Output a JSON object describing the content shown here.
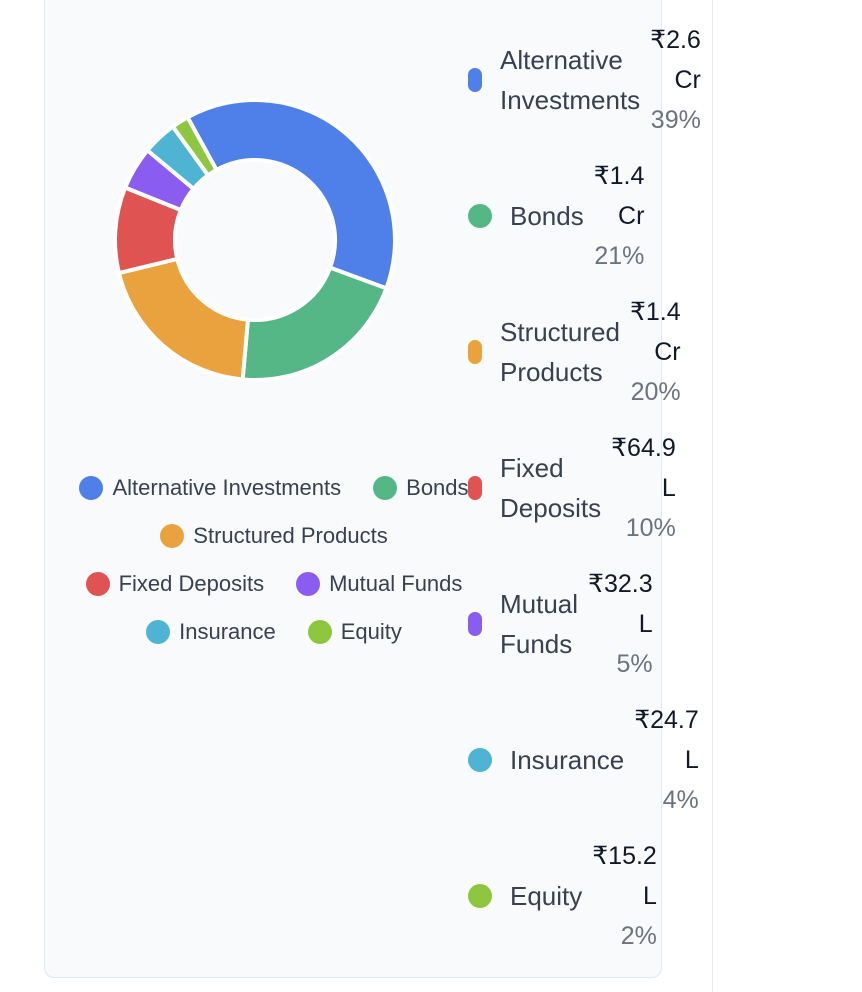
{
  "chart_data": {
    "type": "pie",
    "donut": true,
    "categories": [
      "Alternative Investments",
      "Bonds",
      "Structured Products",
      "Fixed Deposits",
      "Mutual Funds",
      "Insurance",
      "Equity"
    ],
    "values": [
      39,
      21,
      20,
      10,
      5,
      4,
      2
    ],
    "colors": [
      "#4f7fe9",
      "#56b786",
      "#e9a23d",
      "#e05353",
      "#8a5cf0",
      "#4fb4d3",
      "#8dc63f"
    ],
    "legend_position": "bottom"
  },
  "breakdown": [
    {
      "label_lines": [
        "Alternative",
        "Investments"
      ],
      "amount_lines": [
        "₹2.6",
        "Cr"
      ],
      "percent": "39%",
      "color": "#4f7fe9"
    },
    {
      "label_lines": [
        "Bonds"
      ],
      "amount_lines": [
        "₹1.4",
        "Cr"
      ],
      "percent": "21%",
      "color": "#56b786"
    },
    {
      "label_lines": [
        "Structured",
        "Products"
      ],
      "amount_lines": [
        "₹1.4",
        "Cr"
      ],
      "percent": "20%",
      "color": "#e9a23d"
    },
    {
      "label_lines": [
        "Fixed",
        "Deposits"
      ],
      "amount_lines": [
        "₹64.9",
        "L"
      ],
      "percent": "10%",
      "color": "#e05353"
    },
    {
      "label_lines": [
        "Mutual",
        "Funds"
      ],
      "amount_lines": [
        "₹32.3",
        "L"
      ],
      "percent": "5%",
      "color": "#8a5cf0"
    },
    {
      "label_lines": [
        "Insurance"
      ],
      "amount_lines": [
        "₹24.7",
        "L"
      ],
      "percent": "4%",
      "color": "#4fb4d3"
    },
    {
      "label_lines": [
        "Equity"
      ],
      "amount_lines": [
        "₹15.2",
        "L"
      ],
      "percent": "2%",
      "color": "#8dc63f"
    }
  ]
}
